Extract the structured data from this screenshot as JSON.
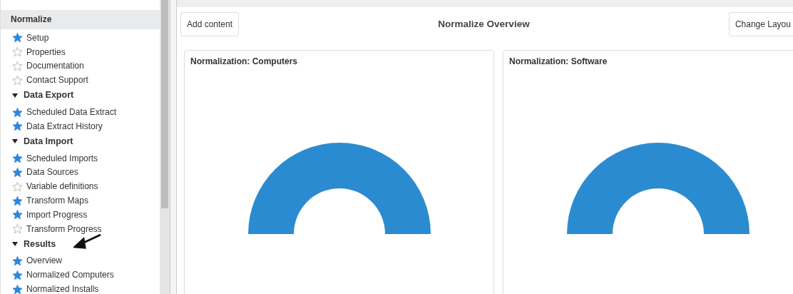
{
  "sidebar": {
    "title": "Normalize",
    "items": [
      {
        "kind": "link",
        "label": "Setup",
        "starred": true
      },
      {
        "kind": "link",
        "label": "Properties",
        "starred": false
      },
      {
        "kind": "link",
        "label": "Documentation",
        "starred": false
      },
      {
        "kind": "link",
        "label": "Contact Support",
        "starred": false
      },
      {
        "kind": "section",
        "label": "Data Export",
        "expanded": true,
        "children": [
          {
            "kind": "link",
            "label": "Scheduled Data Extract",
            "starred": true
          },
          {
            "kind": "link",
            "label": "Data Extract History",
            "starred": true
          }
        ]
      },
      {
        "kind": "section",
        "label": "Data Import",
        "expanded": true,
        "children": [
          {
            "kind": "link",
            "label": "Scheduled Imports",
            "starred": true
          },
          {
            "kind": "link",
            "label": "Data Sources",
            "starred": true
          },
          {
            "kind": "link",
            "label": "Variable definitions",
            "starred": false
          },
          {
            "kind": "link",
            "label": "Transform Maps",
            "starred": true
          },
          {
            "kind": "link",
            "label": "Import Progress",
            "starred": true
          },
          {
            "kind": "link",
            "label": "Transform Progress",
            "starred": false
          }
        ]
      },
      {
        "kind": "section",
        "label": "Results",
        "expanded": true,
        "pointer": true,
        "children": [
          {
            "kind": "link",
            "label": "Overview",
            "starred": true
          },
          {
            "kind": "link",
            "label": "Normalized Computers",
            "starred": true
          },
          {
            "kind": "link",
            "label": "Normalized Installs",
            "starred": true
          }
        ]
      }
    ]
  },
  "toolbar": {
    "add_button": "Add content",
    "title": "Normalize Overview",
    "layout_button": "Change Layou"
  },
  "widgets": [
    {
      "title": "Normalization: Computers",
      "kind": "gauge"
    },
    {
      "title": "Normalization: Software",
      "kind": "gauge"
    }
  ]
}
